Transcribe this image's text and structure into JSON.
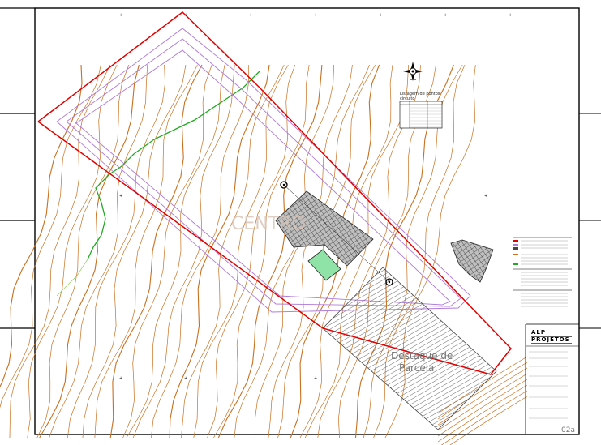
{
  "drawing": {
    "title_table": "Listagem de pontos",
    "title_table_sub": "circuito",
    "watermark": "CENTRO",
    "parcel_label_line1": "Destaque de",
    "parcel_label_line2": "Parcela",
    "sheet_number": "02a",
    "firm_name_line1": "ALP",
    "firm_name_line2": "PROJETOS"
  },
  "colors": {
    "boundary": "#e00000",
    "offset_lines": "#b07ad8",
    "contours": "#c8701f",
    "green_line": "#22aa22",
    "building": "#9a9a9a",
    "pool": "#8fe3a6",
    "frame": "#000000"
  }
}
